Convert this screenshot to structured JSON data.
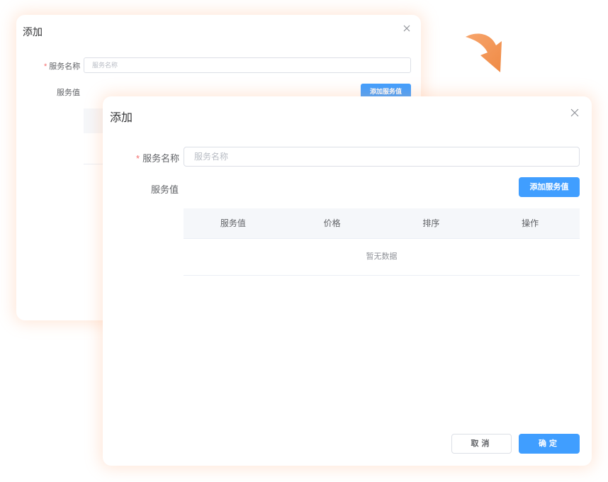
{
  "colors": {
    "primary": "#409eff",
    "required_star": "#f56c6c",
    "arrow_orange": "#f39a5a",
    "dialog_glow": "#ffd9c2"
  },
  "back_dialog": {
    "title": "添加",
    "required_star": "*",
    "service_name_label": "服务名称",
    "service_name_placeholder": "服务名称",
    "service_value_label": "服务值",
    "add_button_label": "添加服务值"
  },
  "front_dialog": {
    "title": "添加",
    "required_star": "*",
    "service_name_label": "服务名称",
    "service_name_placeholder": "服务名称",
    "service_value_label": "服务值",
    "add_button_label": "添加服务值",
    "table": {
      "columns": [
        "服务值",
        "价格",
        "排序",
        "操作"
      ],
      "empty_text": "暂无数据"
    },
    "cancel_label": "取消",
    "confirm_label": "确定"
  },
  "icons": {
    "close": "close-icon",
    "transition_arrow": "curved-arrow-icon"
  }
}
